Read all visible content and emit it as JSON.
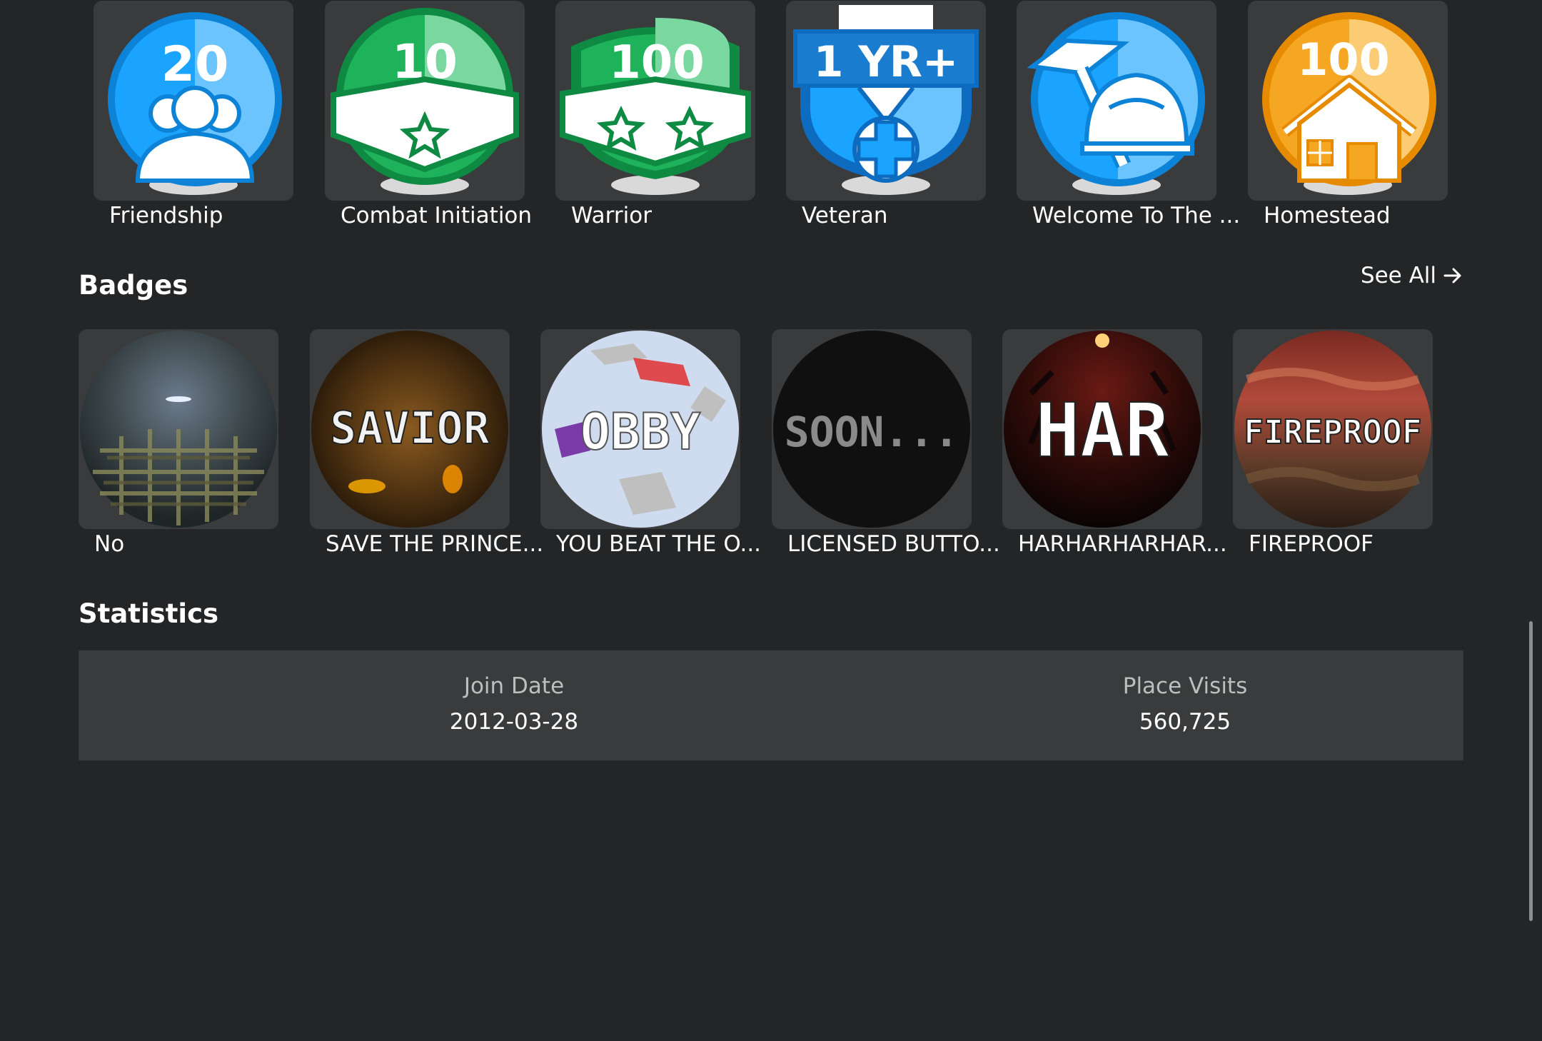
{
  "game_badges": [
    {
      "label": "Friendship",
      "number": "20",
      "icon": "friends-icon",
      "color": "#1aa3ff"
    },
    {
      "label": "Combat Initiation",
      "number": "10",
      "icon": "single-star-ribbon-icon",
      "color": "#1eb35a"
    },
    {
      "label": "Warrior",
      "number": "100",
      "icon": "double-star-ribbon-icon",
      "color": "#1eb35a"
    },
    {
      "label": "Veteran",
      "number": "1 YR+",
      "icon": "veteran-medal-icon",
      "color": "#1aa3ff"
    },
    {
      "label": "Welcome To The ...",
      "number": "",
      "icon": "builder-hat-hammer-icon",
      "color": "#1aa3ff"
    },
    {
      "label": "Homestead",
      "number": "100",
      "icon": "house-icon",
      "color": "#f5a623"
    }
  ],
  "badges": {
    "title": "Badges",
    "see_all": "See All",
    "items": [
      {
        "label": "No",
        "art_text": ""
      },
      {
        "label": "SAVE THE PRINCE...",
        "art_text": "SAVIOR"
      },
      {
        "label": "YOU BEAT THE O...",
        "art_text": "OBBY"
      },
      {
        "label": "LICENSED BUTTO...",
        "art_text": "SOON..."
      },
      {
        "label": "HARHARHARHAR...",
        "art_text": "HAR"
      },
      {
        "label": "FIREPROOF",
        "art_text": "FIREPROOF"
      }
    ]
  },
  "statistics": {
    "title": "Statistics",
    "join_date_label": "Join Date",
    "join_date_value": "2012-03-28",
    "place_visits_label": "Place Visits",
    "place_visits_value": "560,725"
  }
}
